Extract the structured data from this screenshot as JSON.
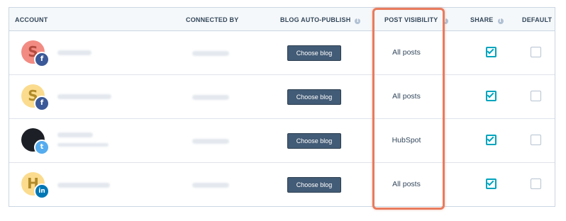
{
  "table": {
    "headers": {
      "account": "ACCOUNT",
      "connected_by": "CONNECTED BY",
      "blog_auto_publish": "BLOG AUTO-PUBLISH",
      "post_visibility": "POST VISIBILITY",
      "share": "SHARE",
      "default": "DEFAULT"
    },
    "info_glyph": "i",
    "rows": [
      {
        "avatar_letter": "S",
        "avatar_color": "#f28b82",
        "avatar_text_color": "#b24a3f",
        "network": "facebook",
        "network_glyph": "f",
        "network_color": "#3b5998",
        "button_label": "Choose blog",
        "visibility": "All posts",
        "share": true,
        "default": false
      },
      {
        "avatar_letter": "S",
        "avatar_color": "#fbdc8e",
        "avatar_text_color": "#b08a2a",
        "network": "facebook",
        "network_glyph": "f",
        "network_color": "#3b5998",
        "button_label": "Choose blog",
        "visibility": "All posts",
        "share": true,
        "default": false
      },
      {
        "avatar_letter": "",
        "avatar_color": "#1c1f26",
        "avatar_text_color": "#ffffff",
        "network": "twitter",
        "network_glyph": "t",
        "network_color": "#55acee",
        "button_label": "Choose blog",
        "visibility": "HubSpot",
        "share": true,
        "default": false
      },
      {
        "avatar_letter": "H",
        "avatar_color": "#fbdc8e",
        "avatar_text_color": "#b08a2a",
        "network": "linkedin",
        "network_glyph": "in",
        "network_color": "#0077b5",
        "button_label": "Choose blog",
        "visibility": "All posts",
        "share": true,
        "default": false
      }
    ]
  },
  "colors": {
    "accent_teal": "#00a4bd",
    "button_bg": "#425b76",
    "highlight": "#e87b5d",
    "header_bg": "#f5f8fa"
  }
}
